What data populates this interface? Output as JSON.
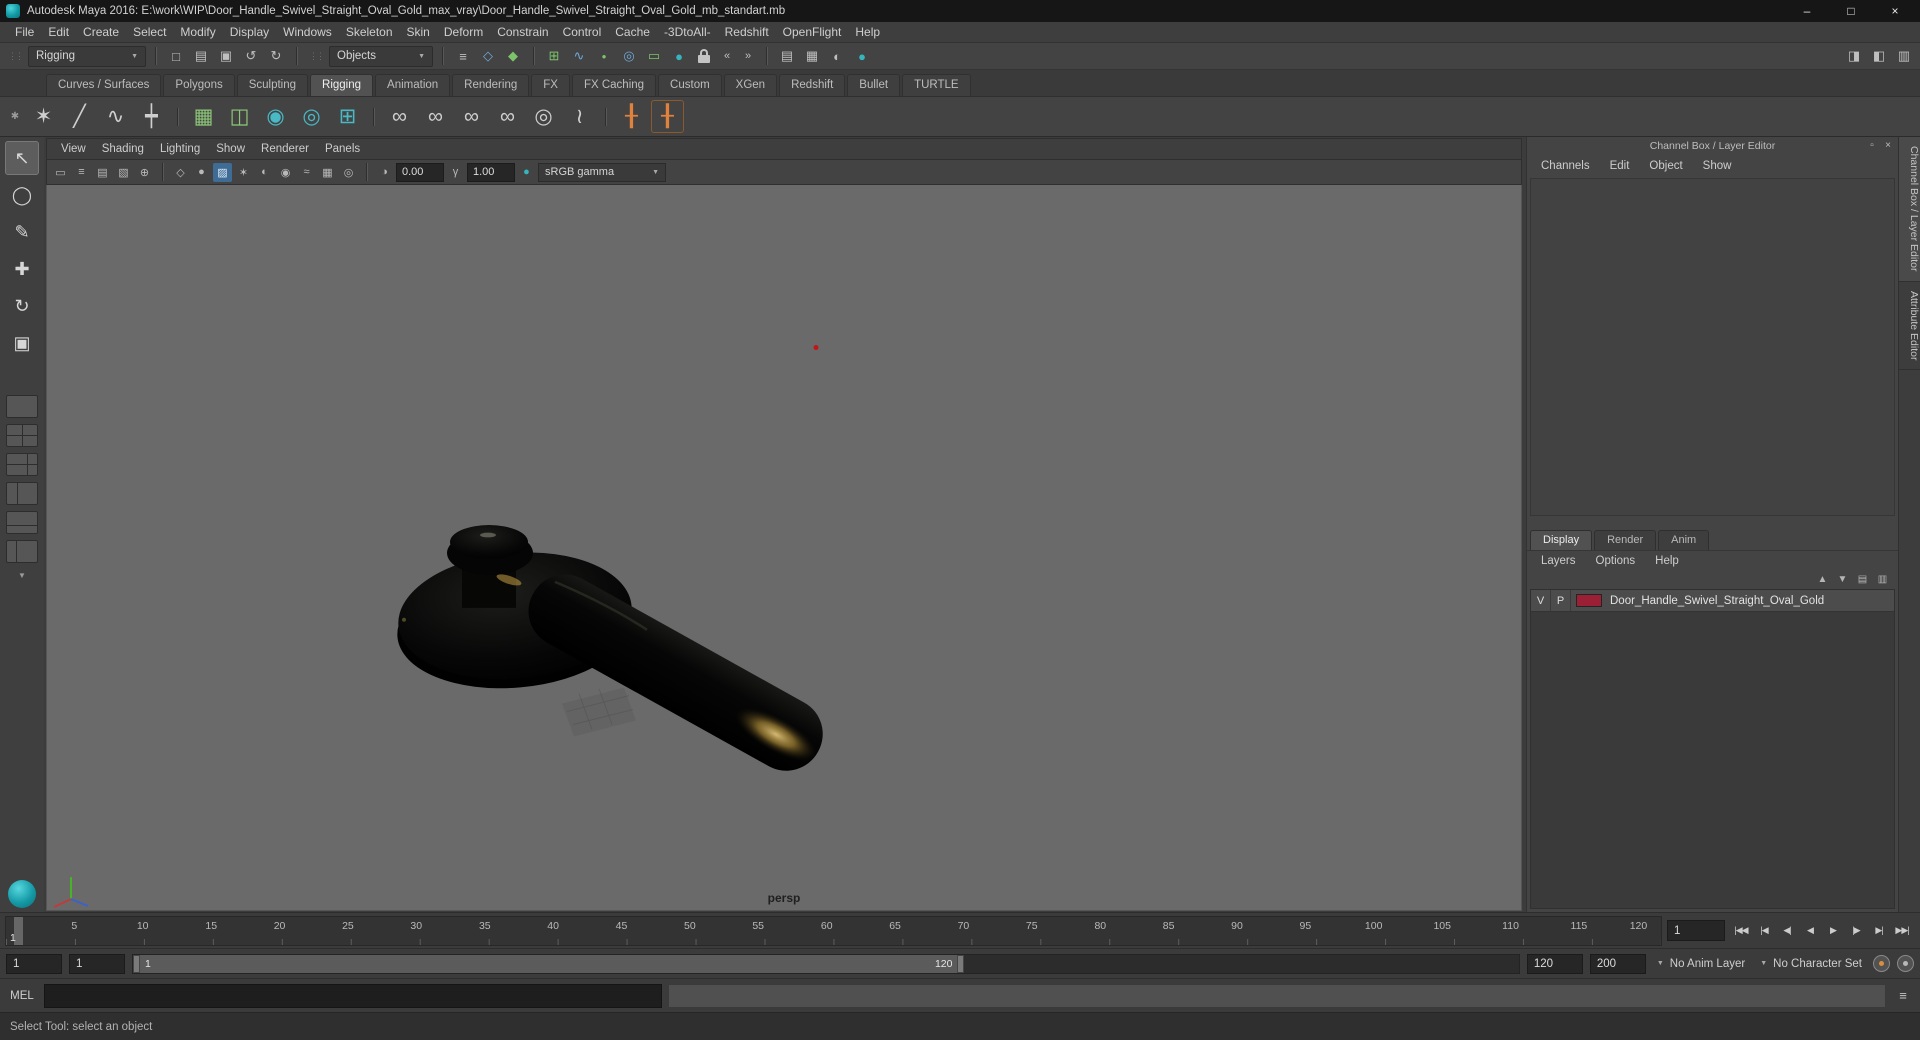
{
  "titlebar": {
    "title": "Autodesk Maya 2016: E:\\work\\WIP\\Door_Handle_Swivel_Straight_Oval_Gold_max_vray\\Door_Handle_Swivel_Straight_Oval_Gold_mb_standart.mb",
    "minimize": "–",
    "maximize": "□",
    "close": "×"
  },
  "menubar": {
    "items": [
      "File",
      "Edit",
      "Create",
      "Select",
      "Modify",
      "Display",
      "Windows",
      "Skeleton",
      "Skin",
      "Deform",
      "Constrain",
      "Control",
      "Cache",
      "-3DtoAll-",
      "Redshift",
      "OpenFlight",
      "Help"
    ]
  },
  "statusline": {
    "menu_set": "Rigging",
    "selection_mask": "Objects"
  },
  "shelf": {
    "tabs": [
      "Curves / Surfaces",
      "Polygons",
      "Sculpting",
      "Rigging",
      "Animation",
      "Rendering",
      "FX",
      "FX Caching",
      "Custom",
      "XGen",
      "Redshift",
      "Bullet",
      "TURTLE"
    ],
    "active_tab": "Rigging",
    "glyphs": [
      "✶",
      "╱",
      "∿",
      "┿",
      "▦",
      "◫",
      "◉",
      "◎",
      "⊞",
      "∞",
      "∞",
      "∞",
      "∞",
      "◎",
      "≀",
      "╂",
      "╂"
    ]
  },
  "viewport": {
    "menus": [
      "View",
      "Shading",
      "Lighting",
      "Show",
      "Renderer",
      "Panels"
    ],
    "exposure": "0.00",
    "gamma": "1.00",
    "view_transform": "sRGB gamma",
    "camera": "persp"
  },
  "channel_box": {
    "title": "Channel Box / Layer Editor",
    "menus": [
      "Channels",
      "Edit",
      "Object",
      "Show"
    ]
  },
  "layer_editor": {
    "tabs": [
      "Display",
      "Render",
      "Anim"
    ],
    "menus": [
      "Layers",
      "Options",
      "Help"
    ],
    "layer": {
      "visible": "V",
      "playback": "P",
      "name": "Door_Handle_Swivel_Straight_Oval_Gold",
      "swatch_style": "background:#9b2035"
    }
  },
  "side_tabs": {
    "channel_box": "Channel Box / Layer Editor",
    "attribute_editor": "Attribute Editor"
  },
  "timeline": {
    "ticks": [
      "5",
      "10",
      "15",
      "20",
      "25",
      "30",
      "35",
      "40",
      "45",
      "50",
      "55",
      "60",
      "65",
      "70",
      "75",
      "80",
      "85",
      "90",
      "95",
      "100",
      "105",
      "110",
      "115",
      "120"
    ],
    "playhead": "1",
    "current_frame": "1",
    "playback": [
      "|◀◀",
      "|◀",
      "◀|",
      "◀",
      "▶",
      "|▶",
      "▶|",
      "▶▶|"
    ]
  },
  "range": {
    "anim_start": "1",
    "playback_start": "1",
    "bar_start": "1",
    "bar_end": "120",
    "playback_end": "120",
    "anim_end": "200",
    "anim_layer": "No Anim Layer",
    "character_set": "No Character Set"
  },
  "command_line": {
    "label": "MEL"
  },
  "help_line": {
    "text": "Select Tool: select an object"
  },
  "colors": {
    "accent_teal": "#18a0a8",
    "layer_swatch": "#9b2035",
    "viewport_background": "#6a6a6a",
    "gold_highlight": "#d9b765"
  },
  "icons": {
    "arrow_down": "▼",
    "grip": "⋮⋮",
    "file_new": "□",
    "file_open": "▤",
    "file_save": "▣",
    "undo": "↺",
    "redo": "↻",
    "select_hierarchy": "≡",
    "select_object": "◇",
    "select_component": "◆",
    "snap_grid": "⊞",
    "snap_curve": "∿",
    "snap_point": "•",
    "snap_projected_center": "◎",
    "snap_view_plane": "▭",
    "make_live": "●",
    "input_connections": "«",
    "output_connections": "»",
    "render_view": "▤",
    "ipr_render": "▦",
    "render_settings": "◐",
    "render_current": "●",
    "toggle_channel_box": "◨",
    "toggle_attribute_editor": "◧",
    "toggle_tool_settings": "▥",
    "gear": "✱",
    "tool_select": "↖",
    "tool_lasso": "◯",
    "tool_paint": "✎",
    "tool_move": "✚",
    "tool_rotate": "↻",
    "tool_scale": "▣",
    "cb_float": "▫",
    "cb_close": "×",
    "le_new_empty": "▤",
    "le_new_selected": "▥",
    "le_move_up": "▲",
    "le_move_down": "▼",
    "script_editor": "≡",
    "vp_select_camera": "▭",
    "vp_camera_attrs": "≡",
    "vp_bookmarks": "▤",
    "vp_image_plane": "▧",
    "vp_pan_zoom": "⊕",
    "vp_wireframe": "◇",
    "vp_smooth_shade": "●",
    "vp_textured": "▨",
    "vp_lights": "✶",
    "vp_shadows": "◐",
    "vp_ao": "◉",
    "vp_motion_blur": "≈",
    "vp_multisample": "▦",
    "vp_isolate": "◎",
    "vp_exposure": "◑",
    "vp_gamma": "γ",
    "vp_color_managed": "●"
  }
}
